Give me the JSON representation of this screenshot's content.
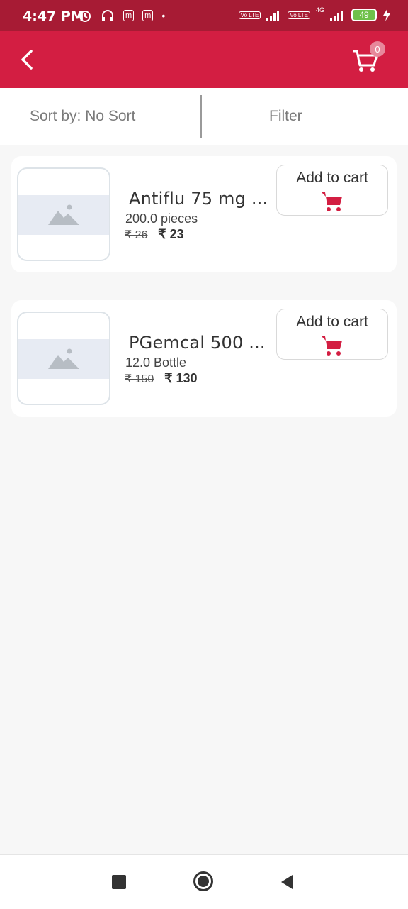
{
  "status_bar": {
    "time": "4:47 PM",
    "sim1_label": "Vo LTE",
    "sim2_label": "Vo LTE",
    "network_type": "4G",
    "battery": "49",
    "icons": [
      "alarm-icon",
      "headset-icon",
      "message-icon",
      "message-icon",
      "dot-icon",
      "signal-icon",
      "signal-icon",
      "charging-icon"
    ]
  },
  "header": {
    "back_icon": "chevron-left-icon",
    "cart_icon": "shopping-cart-icon",
    "cart_count": "0",
    "bg_color": "#d31e42"
  },
  "toolbar": {
    "sort_label": "Sort by: No Sort",
    "filter_label": "Filter"
  },
  "products": [
    {
      "name": "Antiflu 75 mg ...",
      "quantity": "200.0 pieces",
      "old_price": "₹ 26",
      "new_price": "₹ 23",
      "add_label": "Add to cart"
    },
    {
      "name": "PGemcal 500 ...",
      "quantity": "12.0 Bottle",
      "old_price": "₹ 150",
      "new_price": "₹ 130",
      "add_label": "Add to cart"
    }
  ],
  "nav": {
    "icons": [
      "recent-apps-icon",
      "home-icon",
      "back-icon"
    ]
  },
  "colors": {
    "accent": "#d31e42",
    "status_bar": "#a71b34"
  }
}
